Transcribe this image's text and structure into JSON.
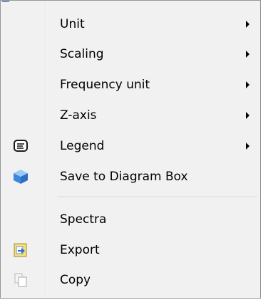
{
  "menu": {
    "items": [
      {
        "label": "Unit",
        "icon": null,
        "submenu": true
      },
      {
        "label": "Scaling",
        "icon": null,
        "submenu": true
      },
      {
        "label": "Frequency unit",
        "icon": null,
        "submenu": true
      },
      {
        "label": "Z-axis",
        "icon": null,
        "submenu": true
      },
      {
        "label": "Legend",
        "icon": "legend-icon",
        "submenu": true
      },
      {
        "label": "Save to Diagram Box",
        "icon": "cube-icon",
        "submenu": false
      },
      {
        "label": "Spectra",
        "icon": null,
        "submenu": false
      },
      {
        "label": "Export",
        "icon": "export-icon",
        "submenu": false
      },
      {
        "label": "Copy",
        "icon": "copy-icon",
        "submenu": false
      }
    ]
  },
  "colors": {
    "background": "#f1f1f1",
    "border": "#979797",
    "text": "#000000",
    "cube": "#4a90e2"
  }
}
